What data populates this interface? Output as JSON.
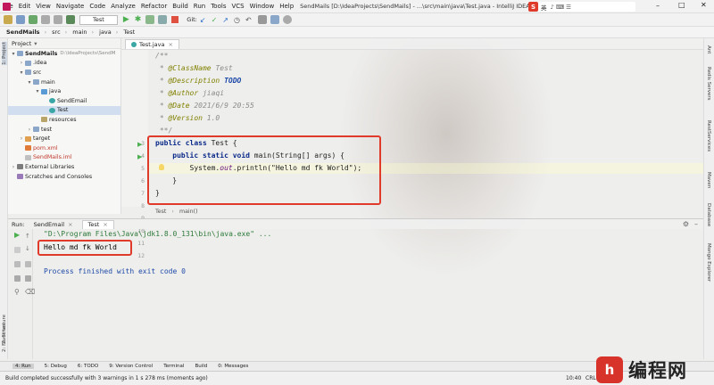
{
  "menubar": {
    "items": [
      "File",
      "Edit",
      "View",
      "Navigate",
      "Code",
      "Analyze",
      "Refactor",
      "Build",
      "Run",
      "Tools",
      "VCS",
      "Window",
      "Help"
    ],
    "title": "SendMails [D:\\IdeaProjects\\SendMails] - ...\\src\\main\\java\\Test.java - IntelliJ IDEA",
    "ime_lang": "英"
  },
  "toolbar": {
    "run_config": "Test",
    "git_label": "Git:"
  },
  "breadcrumb": [
    "SendMails",
    "src",
    "main",
    "java",
    "Test"
  ],
  "project_panel": {
    "title": "Project",
    "tree": [
      {
        "label": "SendMails",
        "path": "D:\\IdeaProjects\\SendM",
        "indent": 0,
        "arrow": "▾",
        "icon": "folder"
      },
      {
        "label": ".idea",
        "indent": 1,
        "arrow": "›",
        "icon": "folder"
      },
      {
        "label": "src",
        "indent": 1,
        "arrow": "▾",
        "icon": "folder"
      },
      {
        "label": "main",
        "indent": 2,
        "arrow": "▾",
        "icon": "folder"
      },
      {
        "label": "java",
        "indent": 3,
        "arrow": "▾",
        "icon": "src"
      },
      {
        "label": "SendEmail",
        "indent": 4,
        "arrow": "",
        "icon": "java"
      },
      {
        "label": "Test",
        "indent": 4,
        "arrow": "",
        "icon": "java",
        "selected": true
      },
      {
        "label": "resources",
        "indent": 3,
        "arrow": "",
        "icon": "res"
      },
      {
        "label": "test",
        "indent": 2,
        "arrow": "›",
        "icon": "folder"
      },
      {
        "label": "target",
        "indent": 1,
        "arrow": "›",
        "icon": "target"
      },
      {
        "label": "pom.xml",
        "indent": 1,
        "arrow": "",
        "icon": "xml"
      },
      {
        "label": "SendMails.iml",
        "indent": 1,
        "arrow": "",
        "icon": "iml"
      },
      {
        "label": "External Libraries",
        "indent": 0,
        "arrow": "›",
        "icon": "lib"
      },
      {
        "label": "Scratches and Consoles",
        "indent": 0,
        "arrow": "",
        "icon": "scratch"
      }
    ]
  },
  "editor": {
    "tab": "Test.java",
    "line_numbers": [
      "3",
      "4",
      "5",
      "6",
      "7",
      "8",
      "9",
      "10",
      "11",
      "12"
    ],
    "crumb": [
      "Test",
      "main()"
    ],
    "code": {
      "c1": "/**",
      "c2": " * ",
      "c2t": "@ClassName",
      "c2v": " Test",
      "c3": " * ",
      "c3t": "@Description",
      "c3v": " TODO",
      "c4": " * ",
      "c4t": "@Author",
      "c4v": " jiaqi",
      "c5": " * ",
      "c5t": "@Date",
      "c5v": " 2021/6/9 20:55",
      "c6": " * ",
      "c6t": "@Version",
      "c6v": " 1.0",
      "c7": " **/",
      "l1a": "public class",
      "l1b": " Test {",
      "l2a": "    public static void",
      "l2b": " main(String[] args) {",
      "l3": "        System.",
      "l3b": "out",
      "l3c": ".println(\"Hello md fk World\");",
      "l4": "    }",
      "l5": "}"
    }
  },
  "run_panel": {
    "label": "Run:",
    "tabs": [
      "SendEmail",
      "Test"
    ],
    "cmd": "\"D:\\Program Files\\Java\\jdk1.8.0_131\\bin\\java.exe\" ...",
    "output": "Hello md fk World",
    "finished": "Process finished with exit code 0"
  },
  "left_stripe": {
    "project": "1: Project",
    "structure": "Z: Structure",
    "favorites": "2: Favorites"
  },
  "right_stripe": [
    "Ant",
    "Redis Servers",
    "RestServices",
    "Maven",
    "Database",
    "Mongo Explorer"
  ],
  "bottom_tools": [
    "4: Run",
    "5: Debug",
    "6: TODO",
    "9: Version Control",
    "Terminal",
    "Build",
    "0: Messages"
  ],
  "status": {
    "message": "Build completed successfully with 3 warnings in 1 s 278 ms (moments ago)",
    "position": "10:40",
    "line_sep": "CRL"
  },
  "watermark": {
    "logo": "h",
    "text": "编程网"
  },
  "colors": {
    "highlight_box": "#e03a2a",
    "keyword": "#0a2a8a",
    "run_green": "#4caf50"
  }
}
